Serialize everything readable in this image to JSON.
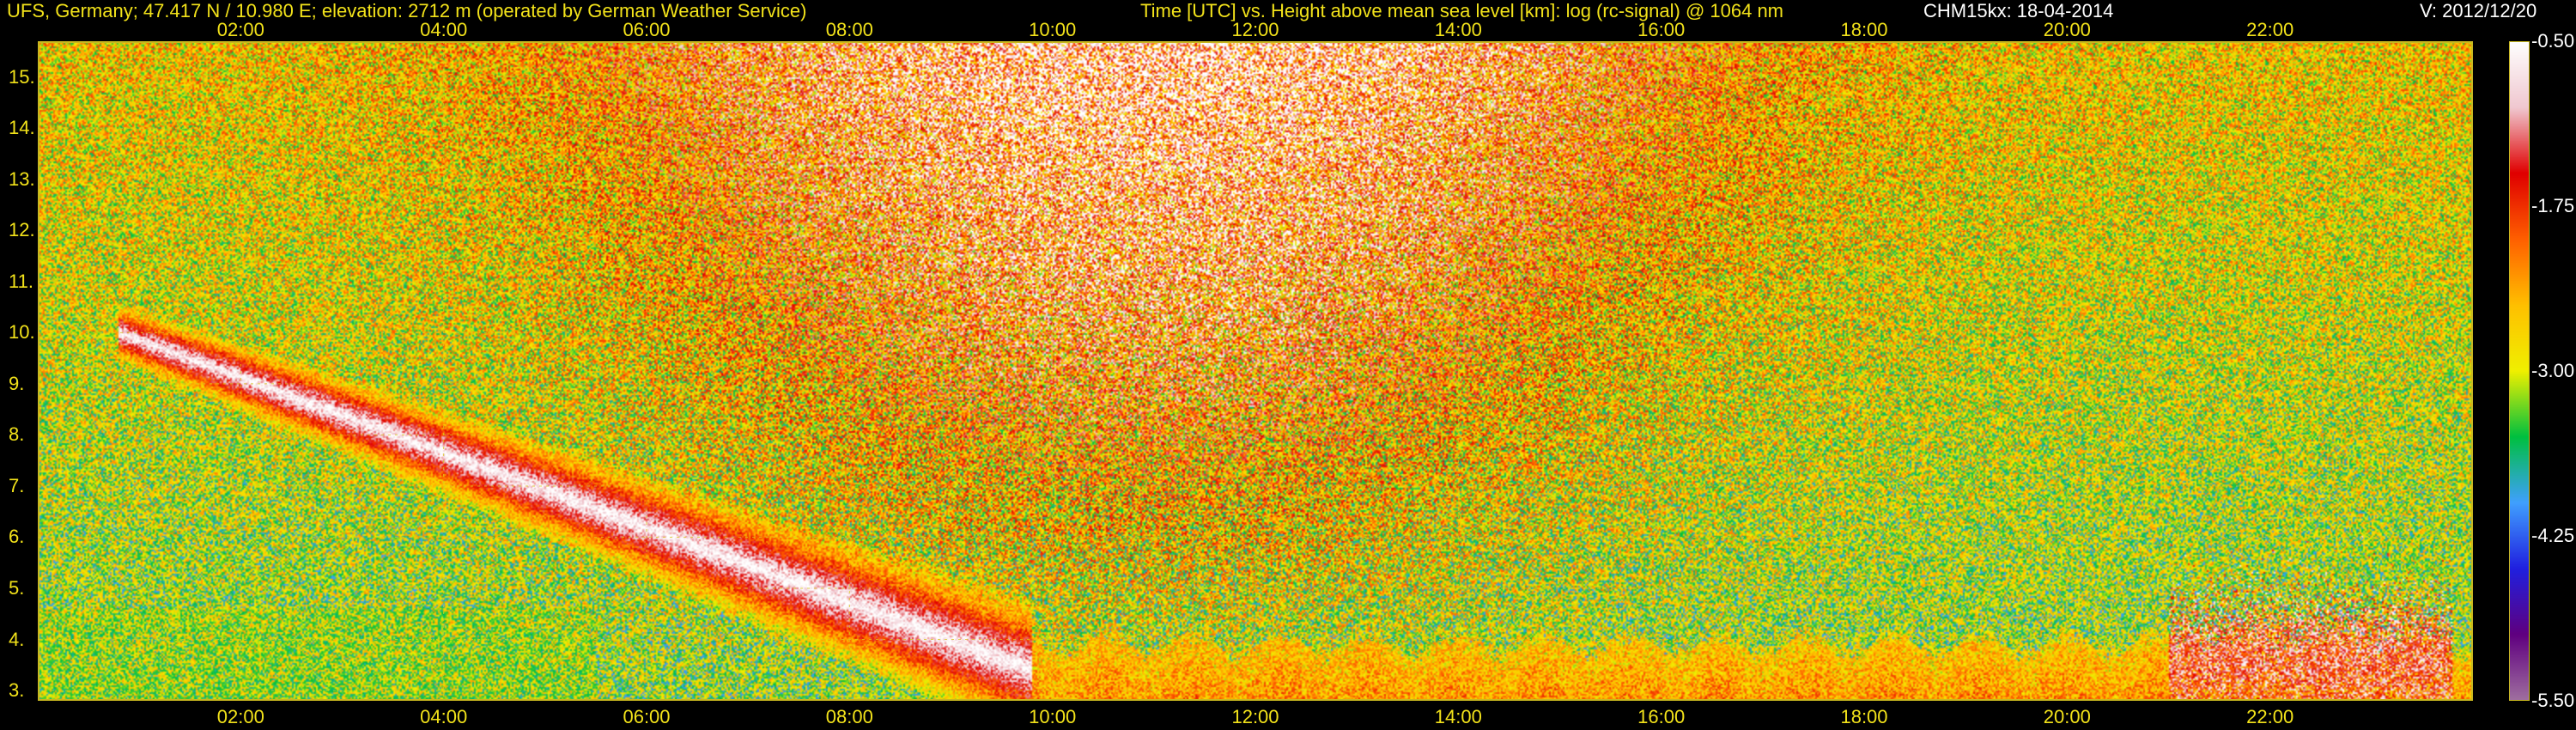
{
  "header": {
    "site": "UFS, Germany; 47.417 N / 10.980 E; elevation: 2712 m  (operated by German Weather Service)",
    "title": "Time [UTC] vs. Height above mean sea level [km]: log (rc-signal) @ 1064 nm",
    "instrument": "CHM15kx: 18-04-2014",
    "version": "V: 2012/12/20"
  },
  "chart_data": {
    "type": "heatmap",
    "title": "Time [UTC] vs. Height above mean sea level [km]: log (rc-signal) @ 1064 nm",
    "xlabel": "Time [UTC]",
    "ylabel": "Height above mean sea level [km]",
    "xlim_hours": [
      0.0,
      24.0
    ],
    "ylim_km": [
      2.8,
      15.7
    ],
    "x_tick_labels": [
      "02:00",
      "04:00",
      "06:00",
      "08:00",
      "10:00",
      "12:00",
      "14:00",
      "16:00",
      "18:00",
      "20:00",
      "22:00"
    ],
    "x_tick_hours": [
      2,
      4,
      6,
      8,
      10,
      12,
      14,
      16,
      18,
      20,
      22
    ],
    "y_tick_labels": [
      "3.",
      "4.",
      "5.",
      "6.",
      "7.",
      "8.",
      "9.",
      "10.",
      "11.",
      "12.",
      "13.",
      "14.",
      "15."
    ],
    "y_tick_km": [
      3,
      4,
      5,
      6,
      7,
      8,
      9,
      10,
      11,
      12,
      13,
      14,
      15
    ],
    "grid": true,
    "colorbar": {
      "range": [
        -5.5,
        -0.5
      ],
      "tick_labels": [
        "-0.50",
        "-1.75",
        "-3.00",
        "-4.25",
        "-5.50"
      ],
      "tick_values": [
        -0.5,
        -1.75,
        -3.0,
        -4.25,
        -5.5
      ],
      "colors": [
        "#ffffff",
        "#f0c8d0",
        "#e00000",
        "#ff6000",
        "#ffc000",
        "#f0f000",
        "#00c040",
        "#40a0ff",
        "#2020e0",
        "#600080",
        "#a070a0"
      ]
    },
    "features": [
      {
        "name": "descending cloud layer",
        "start_hour": 0.8,
        "end_hour": 9.8,
        "start_km": 10.0,
        "end_km": 3.4
      },
      {
        "name": "boundary layer",
        "start_hour": 9.8,
        "end_hour": 24.0,
        "top_km": 4.2
      },
      {
        "name": "evening clouds",
        "start_hour": 21.0,
        "end_hour": 23.8,
        "top_km": 6.3
      }
    ]
  }
}
